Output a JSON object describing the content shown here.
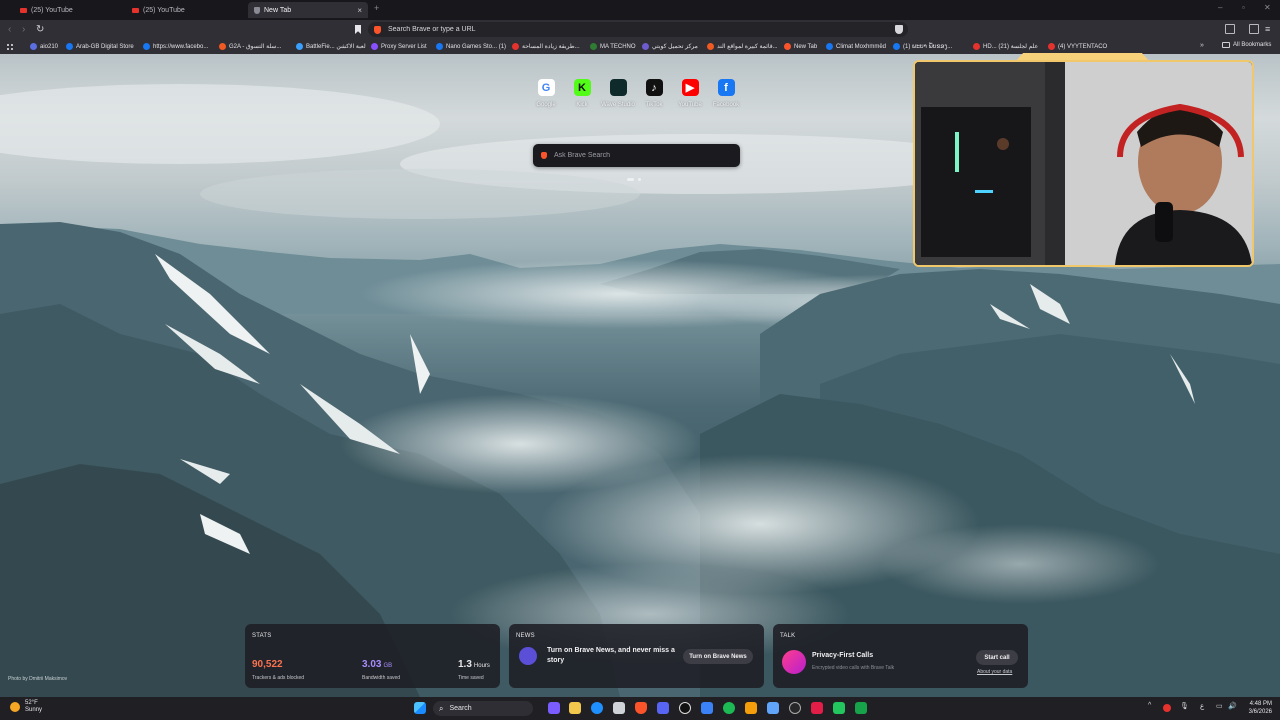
{
  "tabs": [
    {
      "title": "(25) YouTube"
    },
    {
      "title": "(25) YouTube"
    },
    {
      "title": "New Tab",
      "close": "×"
    }
  ],
  "toolbar": {
    "omnibox_placeholder": "Search Brave or type a URL",
    "back": "‹",
    "forward": "›",
    "reload": "↻",
    "new_tab": "+"
  },
  "bookmarks": [
    {
      "label": "aio210",
      "color": "#5b6fe0"
    },
    {
      "label": "Arab-GB Digital Store",
      "color": "#1877f2"
    },
    {
      "label": "https://www.facebo...",
      "color": "#1877f2"
    },
    {
      "label": "G2A - سلة التسوق...",
      "color": "#f05a22"
    },
    {
      "label": "BattleFie... لعبة الاكشن",
      "color": "#3aa0ff"
    },
    {
      "label": "Proxy Server List",
      "color": "#8a4fff"
    },
    {
      "label": "Nano Games Sto... (1)",
      "color": "#1877f2"
    },
    {
      "label": "طريقة زيادة المساحة...",
      "color": "#e5322d"
    },
    {
      "label": "MA TECHNO",
      "color": "#2e7d32"
    },
    {
      "label": "مركز تحميل كوبتي",
      "color": "#6d5bd0"
    },
    {
      "label": "قائمة كبيرة لمواقع الند...",
      "color": "#f05a22"
    },
    {
      "label": "New Tab",
      "color": "#fb542b"
    },
    {
      "label": "Climat Moxhmmëd",
      "color": "#1877f2"
    },
    {
      "label": "(1) ພະບາ ພັບຂອງ...",
      "color": "#1877f2"
    },
    {
      "label": "HD... علم لجلسة (21)",
      "color": "#e5322d"
    },
    {
      "label": "(4) VYYTENTACO",
      "color": "#e5322d"
    }
  ],
  "all_bookmarks": "All Bookmarks",
  "more_bookmarks": "»",
  "top_sites": [
    {
      "name": "Google",
      "glyph": "G",
      "bg": "#ffffff",
      "fg": "#4285f4"
    },
    {
      "name": "Kick",
      "glyph": "K",
      "bg": "#53fc18",
      "fg": "#0b0b0b"
    },
    {
      "name": "Wave Studio",
      "glyph": "",
      "bg": "#0f2a2a",
      "fg": "#39e6c8"
    },
    {
      "name": "TikTok",
      "glyph": "♪",
      "bg": "#111111",
      "fg": "#ffffff"
    },
    {
      "name": "YouTube",
      "glyph": "▶",
      "bg": "#ff0000",
      "fg": "#ffffff"
    },
    {
      "name": "Facebook",
      "glyph": "f",
      "bg": "#1877f2",
      "fg": "#ffffff"
    }
  ],
  "search": {
    "placeholder": "Ask Brave Search"
  },
  "widgets": {
    "stats": {
      "title": "STATS",
      "trackers": {
        "value": "90,522",
        "caption": "Trackers & ads blocked",
        "color": "#fb7250"
      },
      "bandwidth": {
        "value": "3.03",
        "unit": "GB",
        "caption": "Bandwidth saved",
        "color": "#a98cff"
      },
      "time": {
        "value": "1.3",
        "unit": "Hours",
        "caption": "Time saved",
        "color": "#ffffff"
      }
    },
    "news": {
      "title": "NEWS",
      "text": "Turn on Brave News, and never miss a story",
      "button": "Turn on Brave News"
    },
    "talk": {
      "title": "TALK",
      "heading": "Privacy-First Calls",
      "subtitle": "Encrypted video calls with Brave Talk",
      "button": "Start call",
      "link": "About your data"
    }
  },
  "photo_credit": "Photo by Dmitrii Maksimov",
  "taskbar": {
    "weather_temp": "52°F",
    "weather_desc": "Sunny",
    "search": "Search",
    "time": "4:48 PM",
    "date": "3/6/2026",
    "lang": "ع"
  },
  "colors": {
    "accent": "#fb542b",
    "cam_border": "#f0c76a"
  }
}
